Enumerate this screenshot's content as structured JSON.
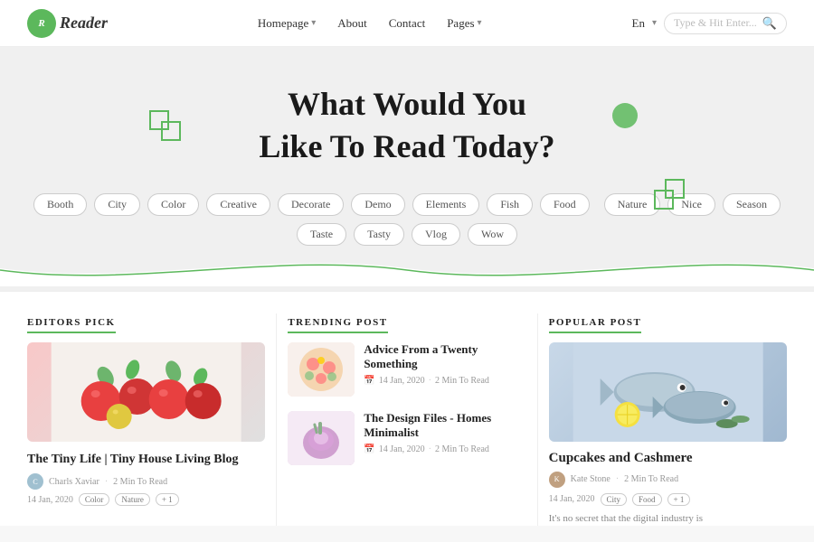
{
  "navbar": {
    "logo_letter": "R",
    "logo_text": "Reader",
    "nav_items": [
      {
        "label": "Homepage",
        "has_arrow": true
      },
      {
        "label": "About",
        "has_arrow": true
      },
      {
        "label": "Contact",
        "has_arrow": false
      },
      {
        "label": "Pages",
        "has_arrow": true
      }
    ],
    "lang": "En",
    "search_placeholder": "Type & Hit Enter..."
  },
  "hero": {
    "heading_line1": "What Would You",
    "heading_line2": "Like To Read Today?",
    "tags": [
      "Booth",
      "City",
      "Color",
      "Creative",
      "Decorate",
      "Demo",
      "Elements",
      "Fish",
      "Food",
      "Nature",
      "Nice",
      "Season",
      "Taste",
      "Tasty",
      "Vlog",
      "Wow"
    ]
  },
  "editors_pick": {
    "section_title": "EDITORS PICK",
    "card_title": "The Tiny Life | Tiny House Living Blog",
    "author": "Charls Xaviar",
    "read_time": "2 Min To Read",
    "date": "14 Jan, 2020",
    "tags": [
      "Color",
      "Nature",
      "+1"
    ]
  },
  "trending_post": {
    "section_title": "TRENDING POST",
    "items": [
      {
        "title": "Advice From a Twenty Something",
        "date": "14 Jan, 2020",
        "read_time": "2 Min To Read"
      },
      {
        "title": "The Design Files - Homes Minimalist",
        "date": "14 Jan, 2020",
        "read_time": "2 Min To Read"
      }
    ]
  },
  "popular_post": {
    "section_title": "POPULAR POST",
    "card_title": "Cupcakes and Cashmere",
    "author": "Kate Stone",
    "read_time": "2 Min To Read",
    "date": "14 Jan, 2020",
    "tags": [
      "City",
      "Food",
      "+1"
    ],
    "description": "It's no secret that the digital industry is"
  }
}
